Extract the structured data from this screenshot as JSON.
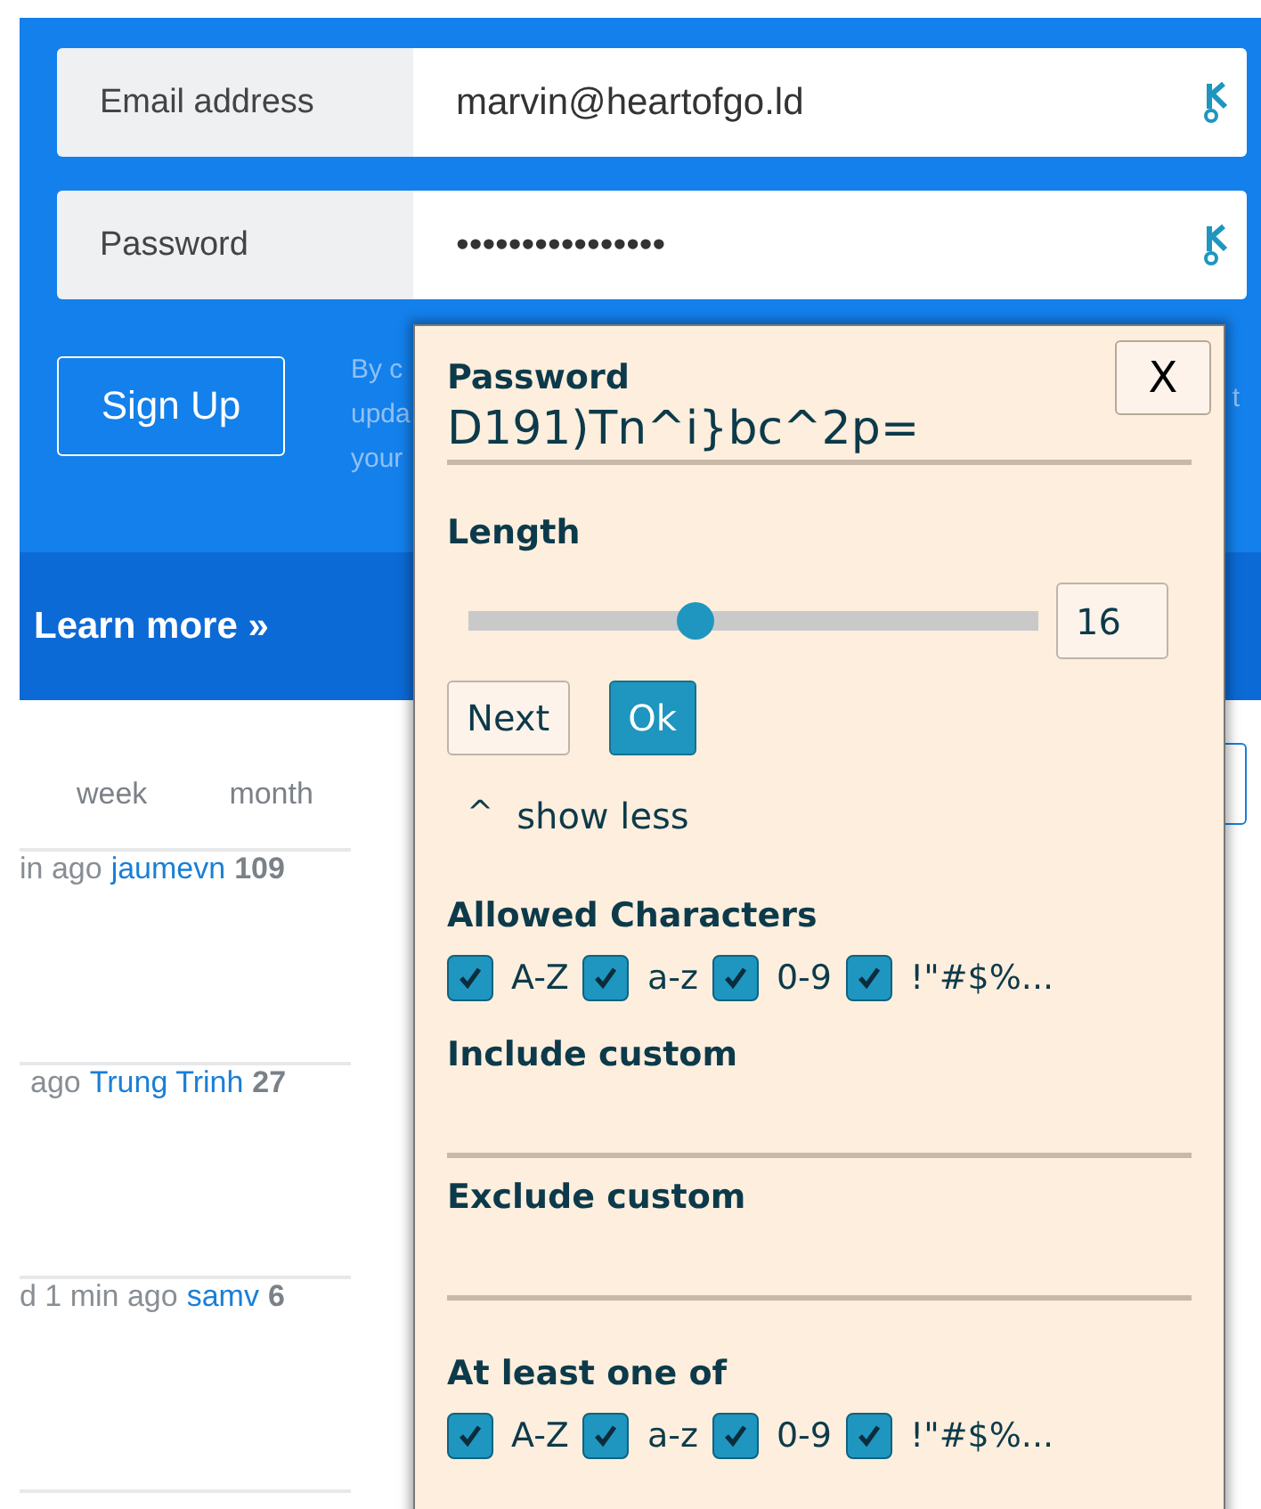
{
  "signup_form": {
    "fields": [
      {
        "label": "Email address",
        "value": "marvin@heartofgo.ld"
      },
      {
        "label": "Password",
        "value": "••••••••••••••••"
      }
    ],
    "button": "Sign Up",
    "terms_lines": [
      "By c",
      "upda",
      "your"
    ],
    "terms_right": "t"
  },
  "learn_more": "Learn more »",
  "period_tabs": [
    "week",
    "month"
  ],
  "activity_rows": [
    {
      "text": "in ago",
      "user": "jaumevn",
      "count": "109"
    },
    {
      "text": "ago",
      "user": "Trung Trinh",
      "count": "27"
    },
    {
      "text": "d 1 min ago",
      "user": "samv",
      "count": "6"
    }
  ],
  "generator": {
    "close": "X",
    "password_label": "Password",
    "password": "D191)Tn^i}bc^2p=",
    "length_label": "Length",
    "length": {
      "level": 0.4
    },
    "length_value": "16",
    "buttons": [
      "Next",
      "Ok"
    ],
    "toggle_icon": "^",
    "toggle": "show less",
    "allowed_label": "Allowed Characters",
    "allowed": [
      {
        "label": "A-Z",
        "checked": true
      },
      {
        "label": "a-z",
        "checked": true
      },
      {
        "label": "0-9",
        "checked": true
      },
      {
        "label": "!\"#$%...",
        "checked": true
      }
    ],
    "include_label": "Include custom",
    "exclude_label": "Exclude custom",
    "at_least_label": "At least one of",
    "at_least": [
      {
        "label": "A-Z",
        "checked": true
      },
      {
        "label": "a-z",
        "checked": true
      },
      {
        "label": "0-9",
        "checked": true
      },
      {
        "label": "!\"#$%...",
        "checked": true
      }
    ]
  }
}
